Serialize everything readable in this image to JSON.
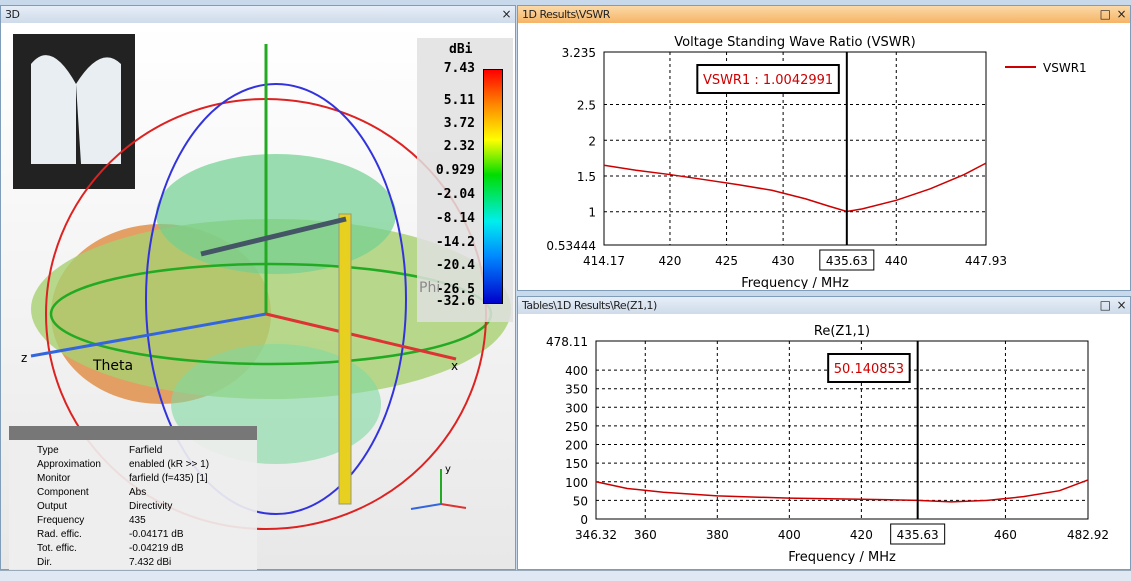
{
  "panels": {
    "view3d": "3D",
    "vswr": "1D Results\\VSWR",
    "rez": "Tables\\1D Results\\Re(Z1,1)",
    "maximize": "□",
    "close": "×"
  },
  "view3d": {
    "axis_labels": {
      "theta": "Theta",
      "phi": "Phi",
      "z": "z",
      "x": "x",
      "y": "y"
    },
    "colorbar": {
      "unit": "dBi",
      "ticks": [
        "7.43",
        "5.11",
        "3.72",
        "2.32",
        "0.929",
        "-2.04",
        "-8.14",
        "-14.2",
        "-20.4",
        "-26.5",
        "-32.6"
      ]
    },
    "info": [
      {
        "k": "Type",
        "v": "Farfield"
      },
      {
        "k": "Approximation",
        "v": "enabled (kR >> 1)"
      },
      {
        "k": "Monitor",
        "v": "farfield (f=435) [1]"
      },
      {
        "k": "Component",
        "v": "Abs"
      },
      {
        "k": "Output",
        "v": "Directivity"
      },
      {
        "k": "Frequency",
        "v": "435"
      },
      {
        "k": "Rad. effic.",
        "v": "-0.04171 dB"
      },
      {
        "k": "Tot. effic.",
        "v": "-0.04219 dB"
      },
      {
        "k": "Dir.",
        "v": "7.432 dBi"
      }
    ]
  },
  "chart_data": [
    {
      "type": "line",
      "title": "Voltage Standing Wave Ratio (VSWR)",
      "xlabel": "Frequency / MHz",
      "ylabel": "",
      "xlim": [
        414.17,
        447.93
      ],
      "ylim": [
        0.53444,
        3.235
      ],
      "xticks": [
        "414.17",
        "420",
        "425",
        "430",
        "435.63",
        "440",
        "447.93"
      ],
      "xtick_values": [
        414.17,
        420,
        425,
        430,
        435.63,
        440,
        447.93
      ],
      "yticks": [
        "3.235",
        "2.5",
        "2",
        "1.5",
        "1",
        "0.53444"
      ],
      "ytick_values": [
        3.235,
        2.5,
        2,
        1.5,
        1,
        0.53444
      ],
      "marker": {
        "x": 435.63,
        "label": "VSWR1 : 1.0042991"
      },
      "legend": "top-right",
      "grid": true,
      "color": "#cc0000",
      "series": [
        {
          "name": "VSWR1",
          "x": [
            414.17,
            417,
            420,
            423,
            426,
            429,
            432,
            434,
            435.63,
            437,
            440,
            443,
            446,
            447.93
          ],
          "y": [
            1.65,
            1.58,
            1.52,
            1.45,
            1.38,
            1.3,
            1.18,
            1.08,
            1.004,
            1.04,
            1.16,
            1.32,
            1.52,
            1.68
          ]
        }
      ]
    },
    {
      "type": "line",
      "title": "Re(Z1,1)",
      "xlabel": "Frequency / MHz",
      "ylabel": "",
      "xlim": [
        346.32,
        482.92
      ],
      "ylim": [
        0,
        478.11
      ],
      "xticks": [
        "346.32",
        "360",
        "380",
        "400",
        "420",
        "435.63",
        "460",
        "482.92"
      ],
      "xtick_values": [
        346.32,
        360,
        380,
        400,
        420,
        435.63,
        460,
        482.92
      ],
      "yticks": [
        "478.11",
        "400",
        "350",
        "300",
        "250",
        "200",
        "150",
        "100",
        "50",
        "0"
      ],
      "ytick_values": [
        478.11,
        400,
        350,
        300,
        250,
        200,
        150,
        100,
        50,
        0
      ],
      "marker": {
        "x": 435.63,
        "label": "50.140853"
      },
      "grid": true,
      "color": "#cc0000",
      "series": [
        {
          "name": "Re(Z1,1)",
          "x": [
            346.32,
            355,
            365,
            380,
            400,
            420,
            435.63,
            445,
            455,
            465,
            475,
            482.92
          ],
          "y": [
            100,
            82,
            72,
            62,
            56,
            53,
            50.14,
            46,
            50,
            60,
            76,
            105
          ]
        }
      ]
    }
  ]
}
